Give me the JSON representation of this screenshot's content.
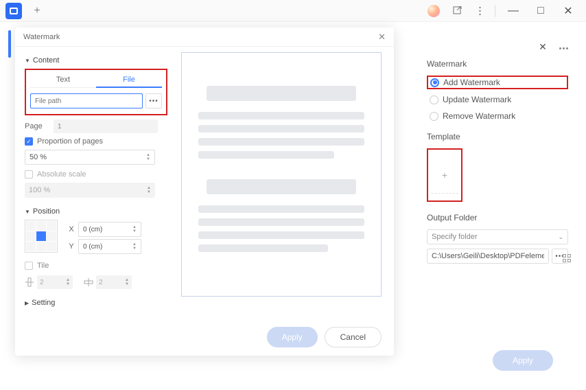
{
  "titlebar": {
    "plus": "+",
    "share_icon": "share-icon",
    "minimize": "—",
    "maximize": "□",
    "close": "✕"
  },
  "side": {
    "close": "✕",
    "title": "Watermark",
    "radios": {
      "add": "Add Watermark",
      "update": "Update Watermark",
      "remove": "Remove Watermark"
    },
    "template_label": "Template",
    "template_plus": "+",
    "output_label": "Output Folder",
    "specify": "Specify folder",
    "path": "C:\\Users\\Geili\\Desktop\\PDFelement\\W",
    "browse_dots": "•••",
    "apply": "Apply"
  },
  "modal": {
    "title": "Watermark",
    "close": "✕",
    "content_label": "Content",
    "tabs": {
      "text": "Text",
      "file": "File"
    },
    "file_placeholder": "File path",
    "browse_dots": "•••",
    "page_label": "Page",
    "page_value": "1",
    "proportion_label": "Proportion of pages",
    "proportion_value": "50 %",
    "absolute_label": "Absolute scale",
    "absolute_value": "100 %",
    "position_label": "Position",
    "x_label": "X",
    "y_label": "Y",
    "xy_value": "0 (cm)",
    "tile_label": "Tile",
    "tile_value": "2",
    "setting_label": "Setting",
    "apply": "Apply",
    "cancel": "Cancel"
  }
}
